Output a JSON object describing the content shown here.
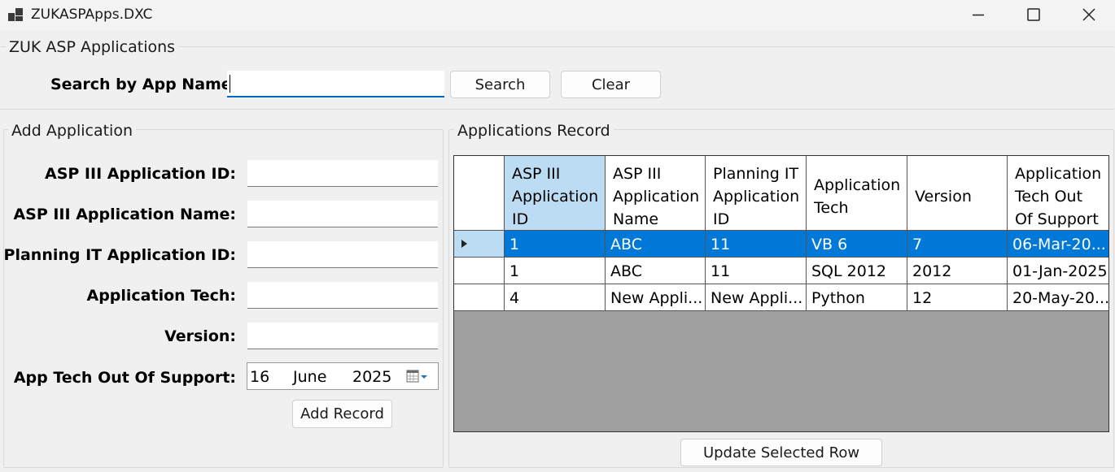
{
  "window": {
    "title": "ZUKASPApps.DXC"
  },
  "search_group": {
    "legend": "ZUK ASP Applications",
    "label": "Search by App Name:",
    "input_value": "",
    "search_label": "Search",
    "clear_label": "Clear"
  },
  "add_group": {
    "legend": "Add Application",
    "fields": [
      {
        "label": "ASP III Application ID:",
        "value": ""
      },
      {
        "label": "ASP III Application Name:",
        "value": ""
      },
      {
        "label": "Planning IT Application ID:",
        "value": ""
      },
      {
        "label": "Application Tech:",
        "value": ""
      },
      {
        "label": "Version:",
        "value": ""
      }
    ],
    "date_label": "App Tech Out Of Support:",
    "date": {
      "day": "16",
      "month": "June",
      "year": "2025"
    },
    "add_button": "Add Record"
  },
  "records_group": {
    "legend": "Applications Record",
    "columns": [
      "ASP III Application ID",
      "ASP III Application Name",
      "Planning IT Application ID",
      "Application Tech",
      "Version",
      "Application Tech Out Of Support"
    ],
    "rows": [
      [
        "1",
        "ABC",
        "11",
        "VB 6",
        "7",
        "06-Mar-20..."
      ],
      [
        "1",
        "ABC",
        "11",
        "SQL 2012",
        "2012",
        "01-Jan-2025"
      ],
      [
        "4",
        "New Appli...",
        "New Appli...",
        "Python",
        "12",
        "20-May-20..."
      ]
    ],
    "selected_row": 0,
    "update_button": "Update Selected Row"
  },
  "colors": {
    "selection": "#0078d7",
    "sorted_header": "#bcdcf4",
    "grid_background": "#a0a0a0",
    "input_underline": "#0067c0"
  },
  "icons": {
    "app": "app-window-icon",
    "minimize": "minimize-icon",
    "maximize": "maximize-icon",
    "close": "close-icon",
    "calendar": "calendar-dropdown-icon",
    "row_indicator": "row-pointer-icon"
  }
}
